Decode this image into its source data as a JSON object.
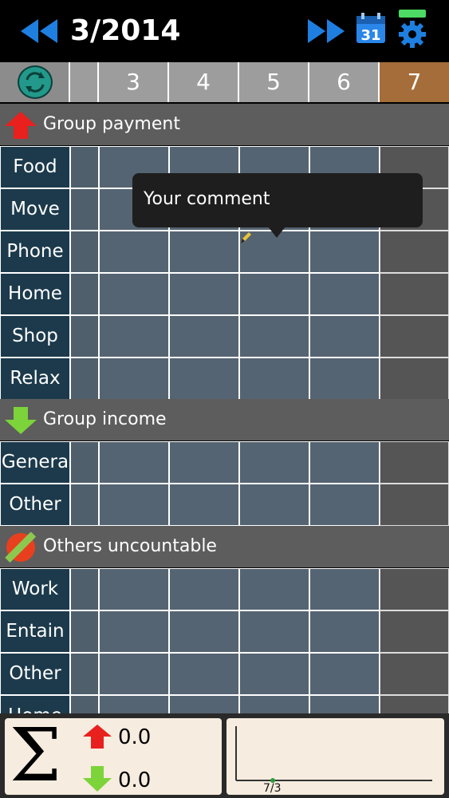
{
  "header": {
    "month_title": "3/2014",
    "prev_icon": "double-left-arrow-icon",
    "next_icon": "double-right-arrow-icon",
    "calendar_icon": "calendar-icon",
    "calendar_day": "31",
    "settings_icon": "gear-icon",
    "accent_color": "#1e7fe0"
  },
  "days": {
    "refresh_icon": "refresh-icon",
    "labels": [
      "3",
      "4",
      "5",
      "6",
      "7"
    ],
    "selected": "7",
    "selected_color": "#a56d3a"
  },
  "sections": {
    "payment": {
      "label": "Group payment",
      "icon": "red-up-arrow-icon",
      "rows": [
        "Food",
        "Move",
        "Phone",
        "Home",
        "Shop",
        "Relax"
      ]
    },
    "income": {
      "label": "Group income",
      "icon": "green-down-arrow-icon",
      "rows": [
        "Genera",
        "Other"
      ]
    },
    "uncountable": {
      "label": "Others uncountable",
      "icon": "slash-circle-icon",
      "rows": [
        "Work",
        "Entain",
        "Other",
        "Home"
      ]
    }
  },
  "tooltip": {
    "text": "Your comment",
    "icon": "pencil-icon"
  },
  "footer": {
    "sigma": "Σ",
    "payment_total": "0.0",
    "income_total": "0.0",
    "graph_label": "7/3"
  }
}
